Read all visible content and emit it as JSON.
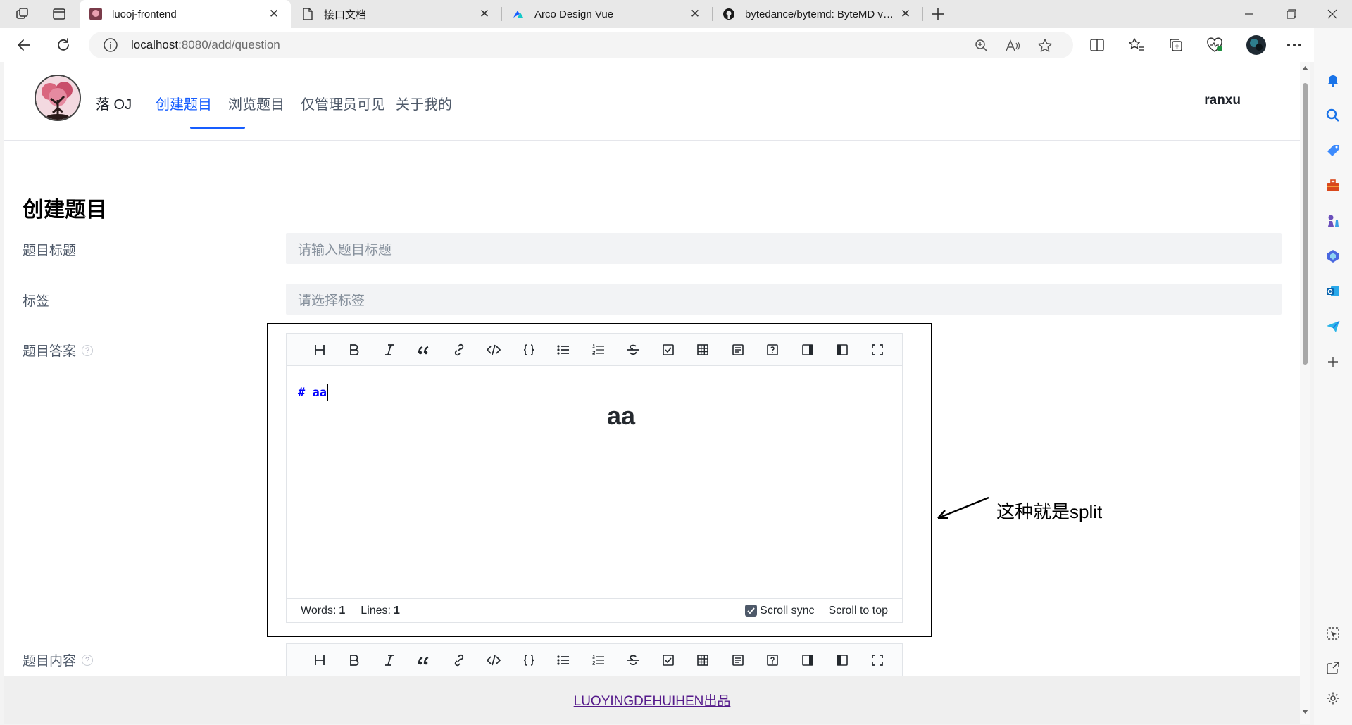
{
  "browser": {
    "tabs": [
      {
        "label": "luooj-frontend",
        "active": true
      },
      {
        "label": "接口文档",
        "active": false
      },
      {
        "label": "Arco Design Vue",
        "active": false
      },
      {
        "label": "bytedance/bytemd: ByteMD v1 is",
        "active": false
      }
    ],
    "url_host": "localhost",
    "url_path": ":8080/add/question"
  },
  "header": {
    "site_title": "落 OJ",
    "menu": [
      {
        "label": "创建题目",
        "active": true
      },
      {
        "label": "浏览题目",
        "active": false
      },
      {
        "label": "仅管理员可见",
        "active": false
      },
      {
        "label": "关于我的",
        "active": false
      }
    ],
    "username": "ranxu"
  },
  "form": {
    "heading": "创建题目",
    "title_label": "题目标题",
    "title_placeholder": "请输入题目标题",
    "tags_label": "标签",
    "tags_placeholder": "请选择标签",
    "answer_label": "题目答案",
    "content_label": "题目内容",
    "help_icon_glyph": "?"
  },
  "editor": {
    "toolbar": [
      "heading-icon",
      "bold-icon",
      "italic-icon",
      "quote-icon",
      "link-icon",
      "code-icon",
      "code-block-icon",
      "unordered-list-icon",
      "ordered-list-icon",
      "strikethrough-icon",
      "task-list-icon",
      "table-icon",
      "toc-icon",
      "help-icon",
      "preview-only-icon",
      "editor-only-icon",
      "fullscreen-icon"
    ],
    "source_text": "# aa",
    "preview_heading": "aa",
    "words_label": "Words:",
    "words_value": "1",
    "lines_label": "Lines:",
    "lines_value": "1",
    "scroll_sync_label": "Scroll sync",
    "scroll_sync_checked": true,
    "scroll_top_label": "Scroll to top"
  },
  "annotation": {
    "text": "这种就是split"
  },
  "footer": {
    "link_text": "LUOYINGDEHUIHEN出品"
  },
  "colors": {
    "primary": "#165dff",
    "footer_link": "#551a8b",
    "code_blue": "#0000ff"
  }
}
